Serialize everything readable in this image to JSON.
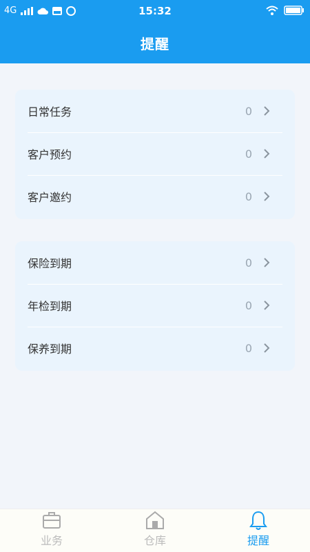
{
  "status": {
    "network": "4G",
    "time": "15:32"
  },
  "header": {
    "title": "提醒"
  },
  "groups": [
    {
      "items": [
        {
          "label": "日常任务",
          "count": "0"
        },
        {
          "label": "客户预约",
          "count": "0"
        },
        {
          "label": "客户邀约",
          "count": "0"
        }
      ]
    },
    {
      "items": [
        {
          "label": "保险到期",
          "count": "0"
        },
        {
          "label": "年检到期",
          "count": "0"
        },
        {
          "label": "保养到期",
          "count": "0"
        }
      ]
    }
  ],
  "tabs": [
    {
      "label": "业务",
      "icon": "briefcase-icon"
    },
    {
      "label": "仓库",
      "icon": "warehouse-icon"
    },
    {
      "label": "提醒",
      "icon": "bell-icon",
      "active": true
    }
  ],
  "colors": {
    "primary": "#1a9cf0",
    "card": "#eaf4fd",
    "background": "#f2f5fa"
  }
}
